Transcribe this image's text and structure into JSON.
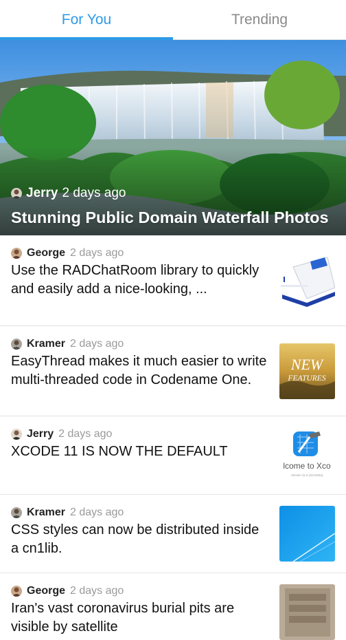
{
  "tabs": [
    {
      "label": "For You",
      "active": true
    },
    {
      "label": "Trending",
      "active": false
    }
  ],
  "featured": {
    "author": "Jerry",
    "time": "2 days ago",
    "title": "Stunning Public Domain Waterfall Photos",
    "image": "waterfall-photo"
  },
  "feed": [
    {
      "author": "George",
      "time": "2 days ago",
      "title": "Use the RADChatRoom library to quickly and easily add a nice-looking, ...",
      "thumbnail": "documents-stack-thumbnail"
    },
    {
      "author": "Kramer",
      "time": "2 days ago",
      "title": "EasyThread  makes it much easier to write multi-threaded code in Codename One.",
      "thumbnail": "new-features-thumbnail",
      "thumb_text": "NEW FEATURES"
    },
    {
      "author": "Jerry",
      "time": "2 days ago",
      "title": "XCODE 11 IS NOW THE DEFAULT",
      "thumbnail": "xcode-welcome-thumbnail",
      "thumb_text": "lcome to Xco",
      "thumb_subtext": "Version 11.0 (11A420a)"
    },
    {
      "author": "Kramer",
      "time": "2 days ago",
      "title": "CSS styles can now be distributed inside a cn1lib.",
      "thumbnail": "blue-gradient-thumbnail"
    },
    {
      "author": "George",
      "time": "2 days ago",
      "title": "Iran's vast coronavirus burial pits are visible by satellite",
      "thumbnail": "satellite-burial-pits-thumbnail"
    }
  ],
  "colors": {
    "accent": "#2e9be6",
    "muted": "#9a9a9a",
    "divider": "#e3e3e3"
  }
}
